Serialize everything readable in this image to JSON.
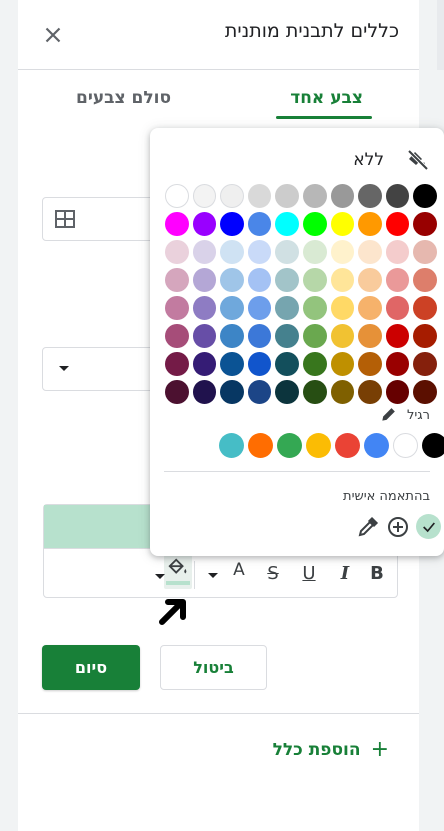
{
  "panel": {
    "title": "כללים לתבנית מותנית",
    "tabs": {
      "single_color": "צבע אחד",
      "color_scale": "סולם צבעים"
    },
    "active_tab": "single_color",
    "accent_color": "#188038",
    "preview_fill": "#b7e1cd"
  },
  "format_toolbar": {
    "bold": "B",
    "italic": "I",
    "underline": "U",
    "strikethrough": "S",
    "text_color": "A"
  },
  "buttons": {
    "done": "סיום",
    "cancel": "ביטול"
  },
  "add_rule": {
    "label": "הוספת כלל",
    "icon": "+"
  },
  "color_picker": {
    "none_label": "ללא",
    "standard_label": "רגיל",
    "custom_label": "בהתאמה אישית",
    "palette": [
      [
        "#000000",
        "#434343",
        "#666666",
        "#999999",
        "#b7b7b7",
        "#cccccc",
        "#d9d9d9",
        "#efefef",
        "#f3f3f3",
        "#ffffff"
      ],
      [
        "#980000",
        "#ff0000",
        "#ff9900",
        "#ffff00",
        "#00ff00",
        "#00ffff",
        "#4a86e8",
        "#0000ff",
        "#9900ff",
        "#ff00ff"
      ],
      [
        "#e6b8af",
        "#f4cccc",
        "#fce5cd",
        "#fff2cc",
        "#d9ead3",
        "#d0e0e3",
        "#c9daf8",
        "#cfe2f3",
        "#d9d2e9",
        "#ead1dc"
      ],
      [
        "#dd7e6b",
        "#ea9999",
        "#f9cb9c",
        "#ffe599",
        "#b6d7a8",
        "#a2c4c9",
        "#a4c2f4",
        "#9fc5e8",
        "#b4a7d6",
        "#d5a6bd"
      ],
      [
        "#cc4125",
        "#e06666",
        "#f6b26b",
        "#ffd966",
        "#93c47d",
        "#76a5af",
        "#6d9eeb",
        "#6fa8dc",
        "#8e7cc3",
        "#c27ba0"
      ],
      [
        "#a61c00",
        "#cc0000",
        "#e69138",
        "#f1c232",
        "#6aa84f",
        "#45818e",
        "#3c78d8",
        "#3d85c6",
        "#674ea7",
        "#a64d79"
      ],
      [
        "#85200c",
        "#990000",
        "#b45f06",
        "#bf9000",
        "#38761d",
        "#134f5c",
        "#1155cc",
        "#0b5394",
        "#351c75",
        "#741b47"
      ],
      [
        "#5b0f00",
        "#660000",
        "#783f04",
        "#7f6000",
        "#274e13",
        "#0c343d",
        "#1c4587",
        "#073763",
        "#20124d",
        "#4c1130"
      ]
    ],
    "standard": [
      "#000000",
      "#ffffff",
      "#4285f4",
      "#ea4335",
      "#fbbc04",
      "#34a853",
      "#ff6d01",
      "#46bdc6"
    ],
    "custom": [
      "#b7e1cd"
    ]
  }
}
